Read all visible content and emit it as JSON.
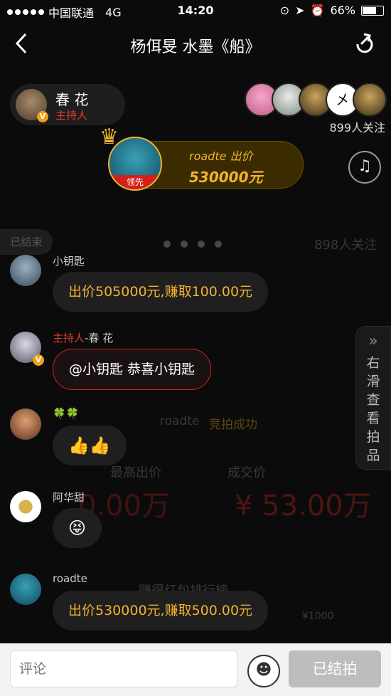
{
  "status_bar": {
    "carrier": "中国联通",
    "network": "4G",
    "time": "14:20",
    "battery": "66%"
  },
  "header": {
    "title": "杨佴旻 水墨《船》"
  },
  "host": {
    "name": "春 花",
    "role": "主持人",
    "badge": "V"
  },
  "followers": {
    "count_label": "899人关注"
  },
  "lead": {
    "bidder": "roadte 出价",
    "price": "530000元",
    "tag": "领先"
  },
  "background": {
    "ended_tag": "已结束",
    "follow_faded": "898人关注",
    "bidder_line": "roadte",
    "result": "竞拍成功",
    "max_bid_label": "最高出价",
    "deal_label": "成交价",
    "max_bid_value": "0.00万",
    "deal_value": "¥ 53.00万",
    "ranking": "赚得红包排行榜",
    "small_value": "¥1000"
  },
  "messages": [
    {
      "name": "小钥匙",
      "text": "出价505000元,赚取100.00元",
      "type": "bid"
    },
    {
      "name_prefix": "主持人",
      "name": "-春 花",
      "text": "@小钥匙 恭喜小钥匙",
      "type": "host"
    },
    {
      "name": "🍀🍀",
      "text": "👍👍",
      "type": "emoji"
    },
    {
      "name": "阿华甜",
      "text": "😝",
      "type": "emoji"
    },
    {
      "name": "roadte",
      "text": "出价530000元,赚取500.00元",
      "type": "bid"
    }
  ],
  "side_tab": {
    "text": "右滑查看拍品",
    "arrow": "»"
  },
  "bottom": {
    "comment_placeholder": "评论",
    "end_button": "已结拍"
  },
  "colors": {
    "accent": "#f3b230",
    "host_red": "#d4201a"
  }
}
